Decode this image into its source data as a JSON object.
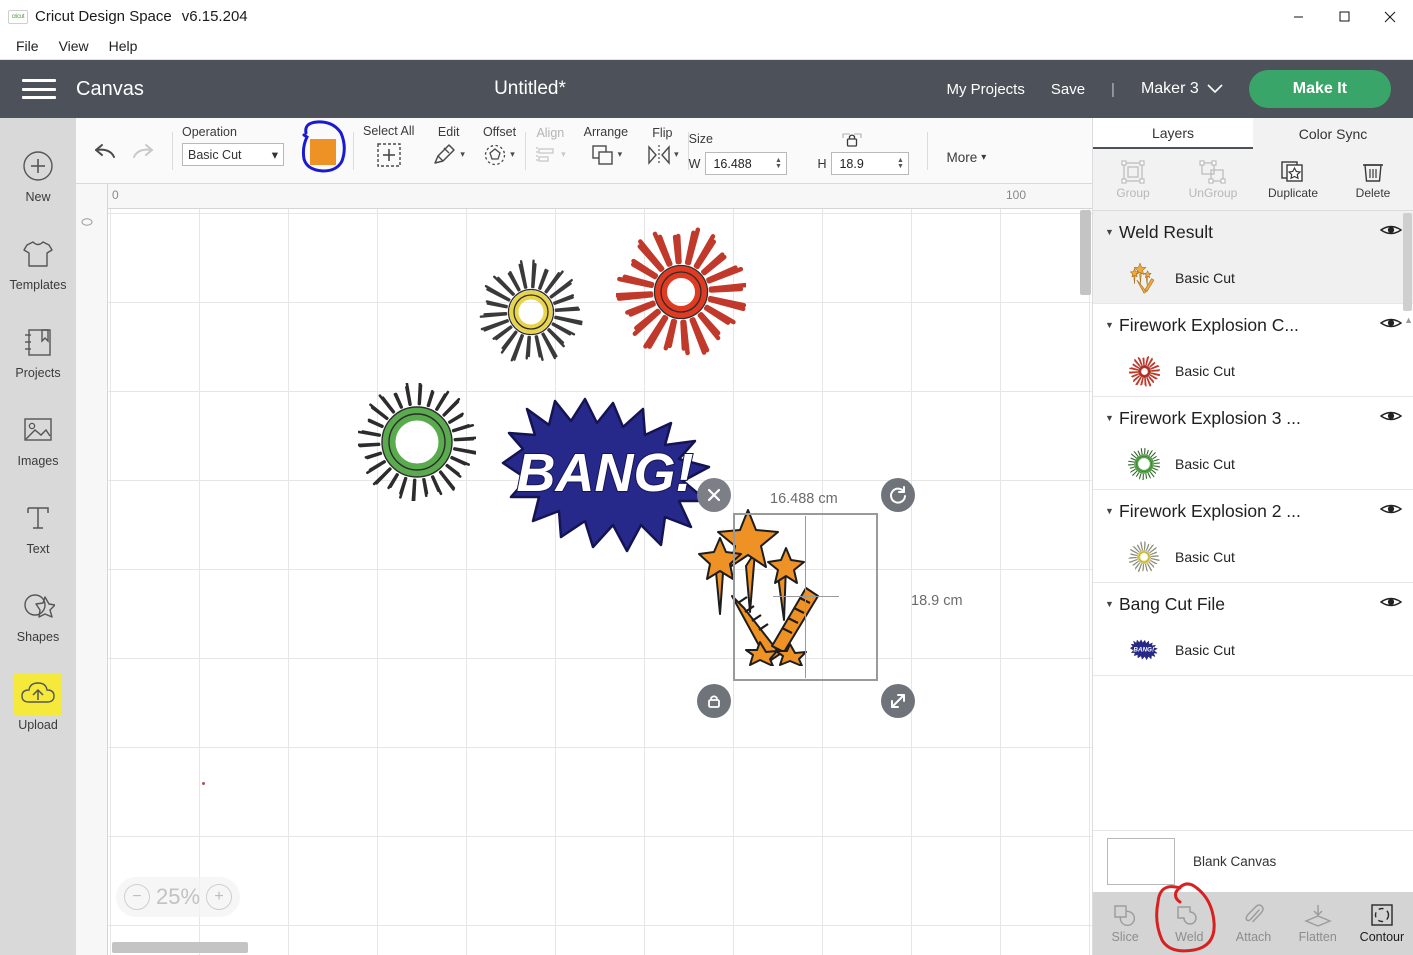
{
  "titlebar": {
    "logo": "cricut-logo",
    "app_name": "Cricut Design Space",
    "version": "v6.15.204",
    "minimize": "—",
    "maximize": "□",
    "close": "✕"
  },
  "menubar": {
    "items": [
      "File",
      "View",
      "Help"
    ]
  },
  "header": {
    "canvas_label": "Canvas",
    "project_title": "Untitled*",
    "my_projects": "My Projects",
    "save": "Save",
    "separator": "|",
    "machine": "Maker 3",
    "chevron": "⌄",
    "make_it": "Make It",
    "bg_color": "#4d525a",
    "make_it_color": "#3aa568"
  },
  "sidebar": {
    "items": [
      {
        "label": "New",
        "icon": "plus-circle-icon",
        "highlighted": false
      },
      {
        "label": "Templates",
        "icon": "tshirt-icon",
        "highlighted": false
      },
      {
        "label": "Projects",
        "icon": "bookmark-book-icon",
        "highlighted": false
      },
      {
        "label": "Images",
        "icon": "picture-icon",
        "highlighted": false
      },
      {
        "label": "Text",
        "icon": "text-t-icon",
        "highlighted": false
      },
      {
        "label": "Shapes",
        "icon": "shapes-icon",
        "highlighted": false
      },
      {
        "label": "Upload",
        "icon": "cloud-upload-icon",
        "highlighted": true
      }
    ],
    "highlight_color": "#f5ea3c"
  },
  "toolbar": {
    "undo": "undo-icon",
    "redo": "redo-icon",
    "operation_label": "Operation",
    "operation_value": "Basic Cut",
    "swatch_color": "#ef9226",
    "select_all": "Select All",
    "edit": "Edit",
    "offset": "Offset",
    "align": "Align",
    "arrange": "Arrange",
    "flip": "Flip",
    "size_label": "Size",
    "width_label": "W",
    "width_value": "16.488",
    "height_label": "H",
    "height_value": "18.9",
    "lock_icon": "lock-closed-icon",
    "more": "More",
    "annotation": "blue-hand-drawn-circle-around-swatch",
    "annotation_color": "#1a1ad0"
  },
  "canvas": {
    "ruler_start": "0",
    "ruler_end": "100",
    "zoom_out": "−",
    "zoom_level": "25%",
    "zoom_in": "+",
    "selection": {
      "width_text": "16.488 cm",
      "height_text": "18.9 cm",
      "delete_icon": "close-x-icon",
      "rotate_icon": "rotate-icon",
      "lock_icon": "lock-icon",
      "resize_icon": "resize-diagonal-icon"
    },
    "artwork": [
      {
        "name": "firework-burst-yellow",
        "color": "#e8d44a"
      },
      {
        "name": "firework-burst-red",
        "color": "#d4342a"
      },
      {
        "name": "firework-burst-green",
        "color": "#5aab4e"
      },
      {
        "name": "bang-starburst",
        "color": "#27298a",
        "text": "BANG!"
      },
      {
        "name": "stars-rockets-selected",
        "color": "#ef9226"
      }
    ]
  },
  "right_panel": {
    "tabs": [
      {
        "label": "Layers",
        "active": true
      },
      {
        "label": "Color Sync",
        "active": false
      }
    ],
    "actions": [
      {
        "label": "Group",
        "icon": "group-icon",
        "enabled": false
      },
      {
        "label": "UnGroup",
        "icon": "ungroup-icon",
        "enabled": false
      },
      {
        "label": "Duplicate",
        "icon": "duplicate-icon",
        "enabled": true
      },
      {
        "label": "Delete",
        "icon": "trash-icon",
        "enabled": true
      }
    ],
    "layers": [
      {
        "name": "Weld Result",
        "child": "Basic Cut",
        "thumb": "stars-rockets-thumb",
        "selected": true,
        "visible": true
      },
      {
        "name": "Firework Explosion C...",
        "child": "Basic Cut",
        "thumb": "firework-red-thumb",
        "selected": false,
        "visible": true
      },
      {
        "name": "Firework Explosion 3 ...",
        "child": "Basic Cut",
        "thumb": "firework-green-thumb",
        "selected": false,
        "visible": true
      },
      {
        "name": "Firework Explosion 2 ...",
        "child": "Basic Cut",
        "thumb": "firework-yellow-thumb",
        "selected": false,
        "visible": true
      },
      {
        "name": "Bang Cut File",
        "child": "Basic Cut",
        "thumb": "bang-thumb",
        "selected": false,
        "visible": true
      }
    ],
    "canvas_row": {
      "label": "Blank Canvas",
      "thumb": "blank-canvas-thumb"
    },
    "operations": [
      {
        "label": "Slice",
        "icon": "slice-icon",
        "enabled": false
      },
      {
        "label": "Weld",
        "icon": "weld-icon",
        "enabled": false
      },
      {
        "label": "Attach",
        "icon": "paperclip-icon",
        "enabled": false
      },
      {
        "label": "Flatten",
        "icon": "flatten-icon",
        "enabled": false
      },
      {
        "label": "Contour",
        "icon": "contour-icon",
        "enabled": true
      }
    ],
    "annotation": "red-hand-drawn-circle-around-weld",
    "annotation_color": "#d92020"
  }
}
